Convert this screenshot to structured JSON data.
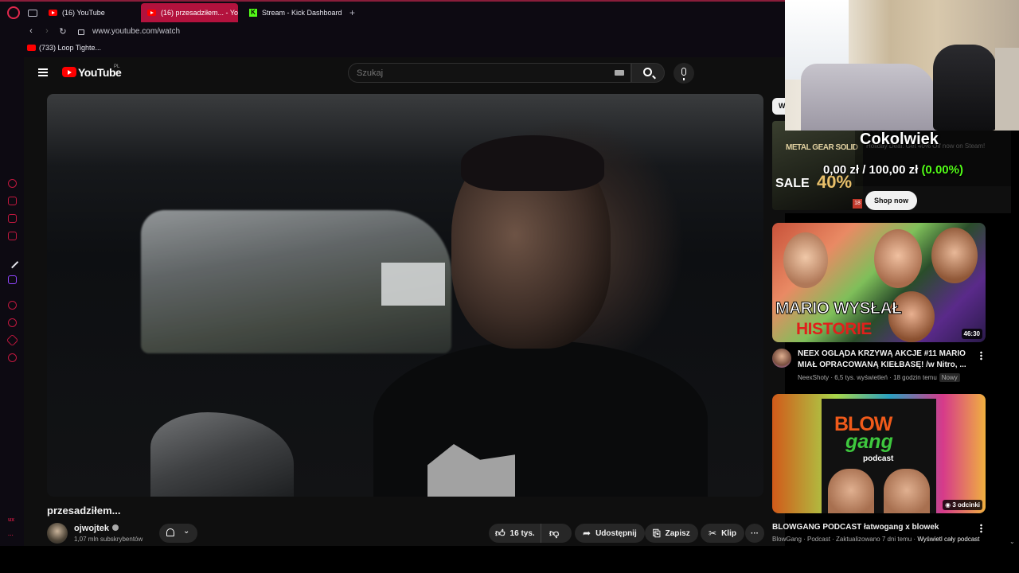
{
  "browser": {
    "tabs": [
      {
        "label": "(16) YouTube",
        "active": false
      },
      {
        "label": "(16) przesadziłem... - You",
        "active": true
      },
      {
        "label": "Stream - Kick Dashboard",
        "active": false
      }
    ],
    "url": "www.youtube.com/watch",
    "bookmark": "(733) Loop Tighte...",
    "sidebar_labels": {
      "ux": "ux",
      "more": "···"
    }
  },
  "youtube": {
    "logo": "YouTube",
    "region": "PL",
    "search_placeholder": "Szukaj",
    "video": {
      "title": "przesadziłem...",
      "channel": "ojwojtek",
      "subscribers": "1,07 mln subskrybentów",
      "likes": "16 tys.",
      "share": "Udostępnij",
      "save": "Zapisz",
      "clip": "Klip"
    },
    "ad": {
      "thumb_title": "METAL GEAR SOLID",
      "thumb_sale": "SALE",
      "thumb_discount": "40%",
      "age_rating": "18",
      "text": "Holiday Deal: Get 40% Off now on Steam!",
      "cta": "Shop now",
      "partial_chip": "W"
    },
    "recommendations": [
      {
        "title": "NEEX OGLĄDA KRZYWĄ AKCJE #11 MARIO MIAŁ OPRACOWANĄ KIEŁBASĘ! /w Nitro, ...",
        "channel": "NeexShoty",
        "views": "6,5 tys. wyświetleń",
        "age": "18 godzin temu",
        "badge": "Nowy",
        "duration": "46:30",
        "overlay_line1": "MARIO WYSŁAŁ",
        "overlay_line2": "HISTORIE"
      },
      {
        "title": "BLOWGANG PODCAST łatwogang x blowek",
        "meta": "BlowGang · Podcast · Zaktualizowano 7 dni temu · ",
        "meta_link": "Wyświetl cały podcast",
        "episodes": "3 odcinki",
        "thumb_blow": "BLOW",
        "thumb_gang": "gang",
        "thumb_podcast": "podcast"
      }
    ]
  },
  "stream_overlay": {
    "goal_title": "Cokolwiek",
    "current": "0,00 zł",
    "separator": " / ",
    "target": "100,00 zł",
    "percent": "(0.00%)"
  },
  "colors": {
    "browser_accent": "#b3123d",
    "yt_red": "#ff0000",
    "kick_green": "#53fc18"
  }
}
